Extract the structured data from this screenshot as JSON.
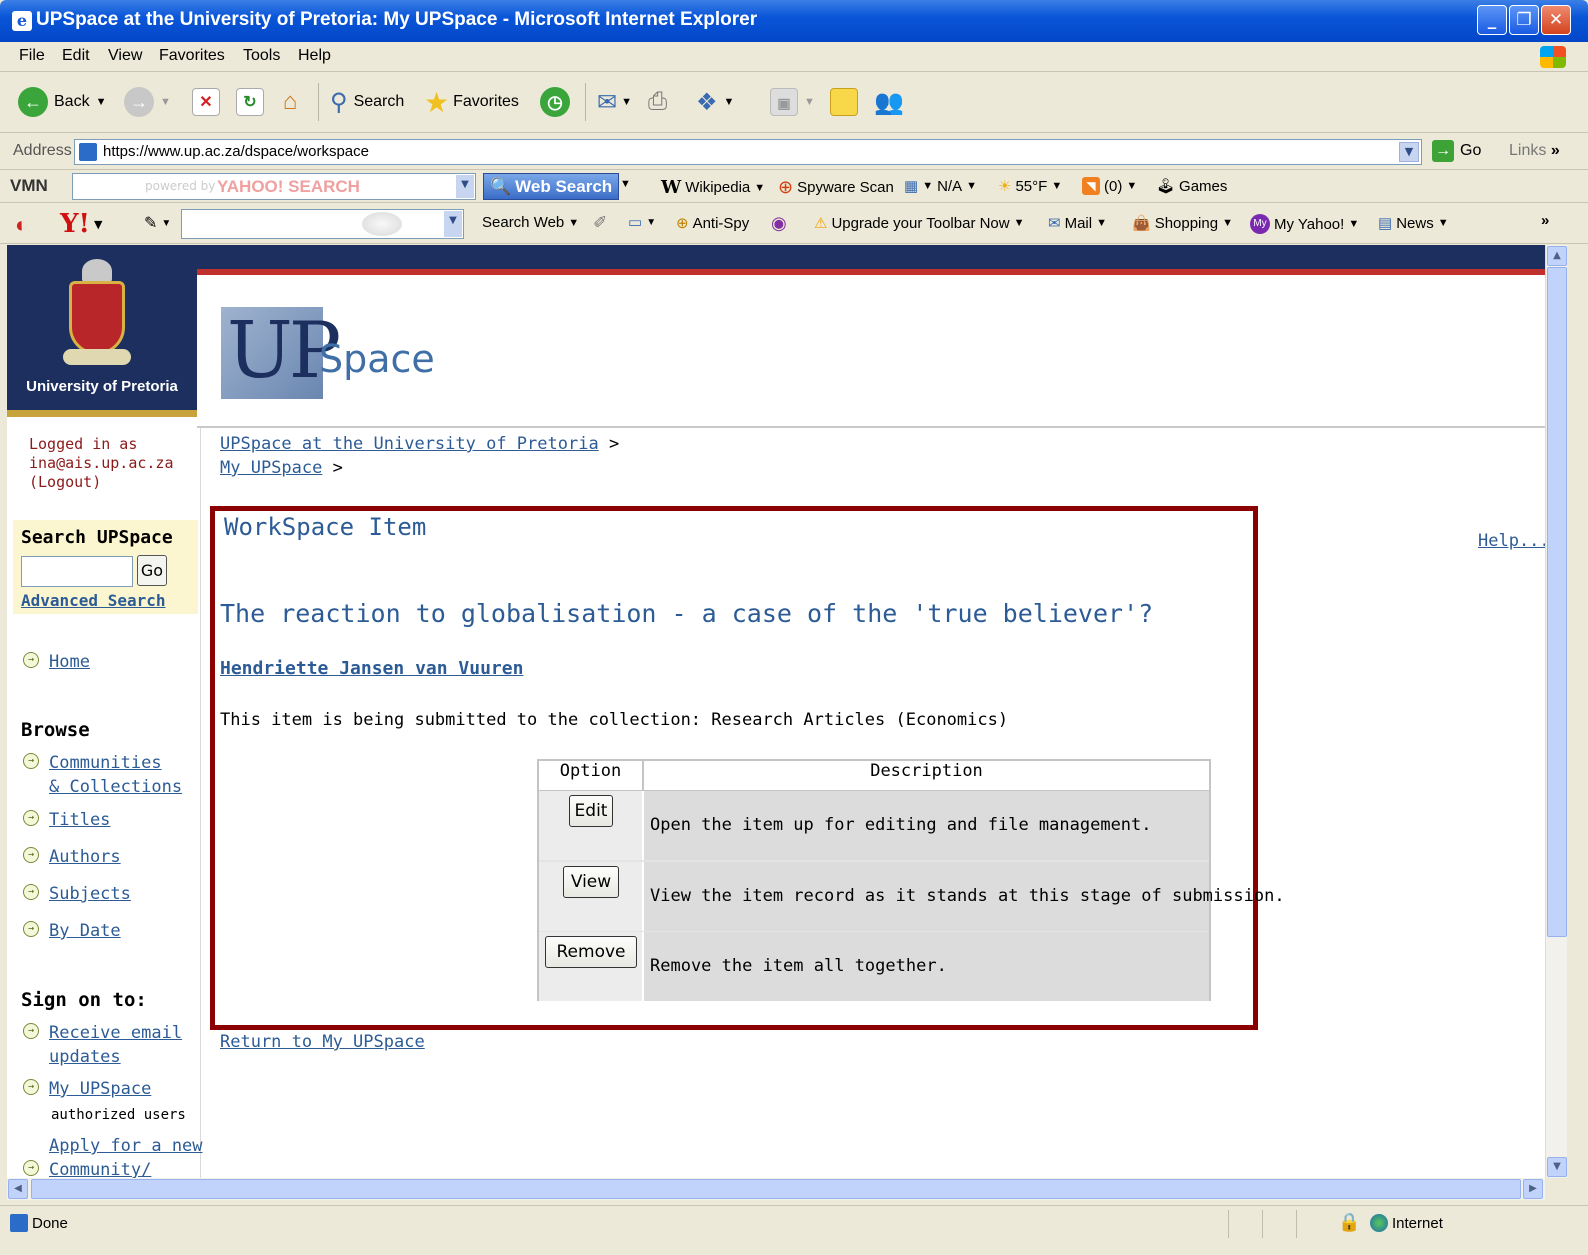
{
  "window": {
    "title": "UPSpace at the University of Pretoria: My UPSpace - Microsoft Internet Explorer",
    "controls": [
      "_",
      "❐",
      "✕"
    ]
  },
  "menu": [
    "File",
    "Edit",
    "View",
    "Favorites",
    "Tools",
    "Help"
  ],
  "toolbar": {
    "back": "Back",
    "search": "Search",
    "favorites": "Favorites"
  },
  "address": {
    "label": "Address",
    "url": "https://www.up.ac.za/dspace/workspace",
    "go": "Go",
    "links": "Links"
  },
  "vmn_bar": {
    "logo": "VMN",
    "powered": "powered by",
    "yahoo": "YAHOO! SEARCH",
    "web_search": "Web Search",
    "wikipedia": "Wikipedia",
    "spyware": "Spyware Scan",
    "na": "N/A",
    "temp": "55°F",
    "rss": "(0)",
    "games": "Games"
  },
  "yahoo_toolbar": {
    "search_web": "Search Web",
    "anti_spy": "Anti-Spy",
    "upgrade": "Upgrade your Toolbar Now",
    "mail": "Mail",
    "shopping": "Shopping",
    "my_yahoo": "My Yahoo!",
    "news": "News"
  },
  "site": {
    "university": "University of Pretoria",
    "logo_up": "UP",
    "logo_space": "Space"
  },
  "sidebar": {
    "logged_in": "Logged in as",
    "email": "ina@ais.up.ac.za",
    "logout": "Logout",
    "search_heading": "Search UPSpace",
    "go": "Go",
    "advanced_search": "Advanced Search",
    "home": "Home",
    "browse_heading": "Browse",
    "communities_1": "Communities",
    "communities_2": "& Collections",
    "titles": "Titles",
    "authors": "Authors",
    "subjects": "Subjects",
    "by_date": "By Date",
    "sign_on_heading": "Sign on to:",
    "receive_1": "Receive email",
    "receive_2": "updates",
    "my_upspace": "My UPSpace",
    "authorized": "authorized users",
    "apply_1": "Apply for a new",
    "apply_2": "Community/"
  },
  "breadcrumb": {
    "item1": "UPSpace at the University of Pretoria",
    "item2": "My UPSpace",
    "sep": ">"
  },
  "main": {
    "heading": "WorkSpace Item",
    "help": "Help...",
    "item_title": "The reaction to globalisation - a case of the 'true believer'?",
    "author": "Hendriette Jansen van Vuuren",
    "collection_text": "This item is being submitted to the collection: Research Articles (Economics)",
    "table": {
      "col_option": "Option",
      "col_description": "Description",
      "rows": [
        {
          "button": "Edit",
          "description": "Open the item up for editing and file management."
        },
        {
          "button": "View",
          "description": "View the item record as it stands at this stage of submission."
        },
        {
          "button": "Remove",
          "description": "Remove the item all together."
        }
      ]
    },
    "return_link": "Return to My UPSpace"
  },
  "status": {
    "text": "Done",
    "zone": "Internet"
  }
}
